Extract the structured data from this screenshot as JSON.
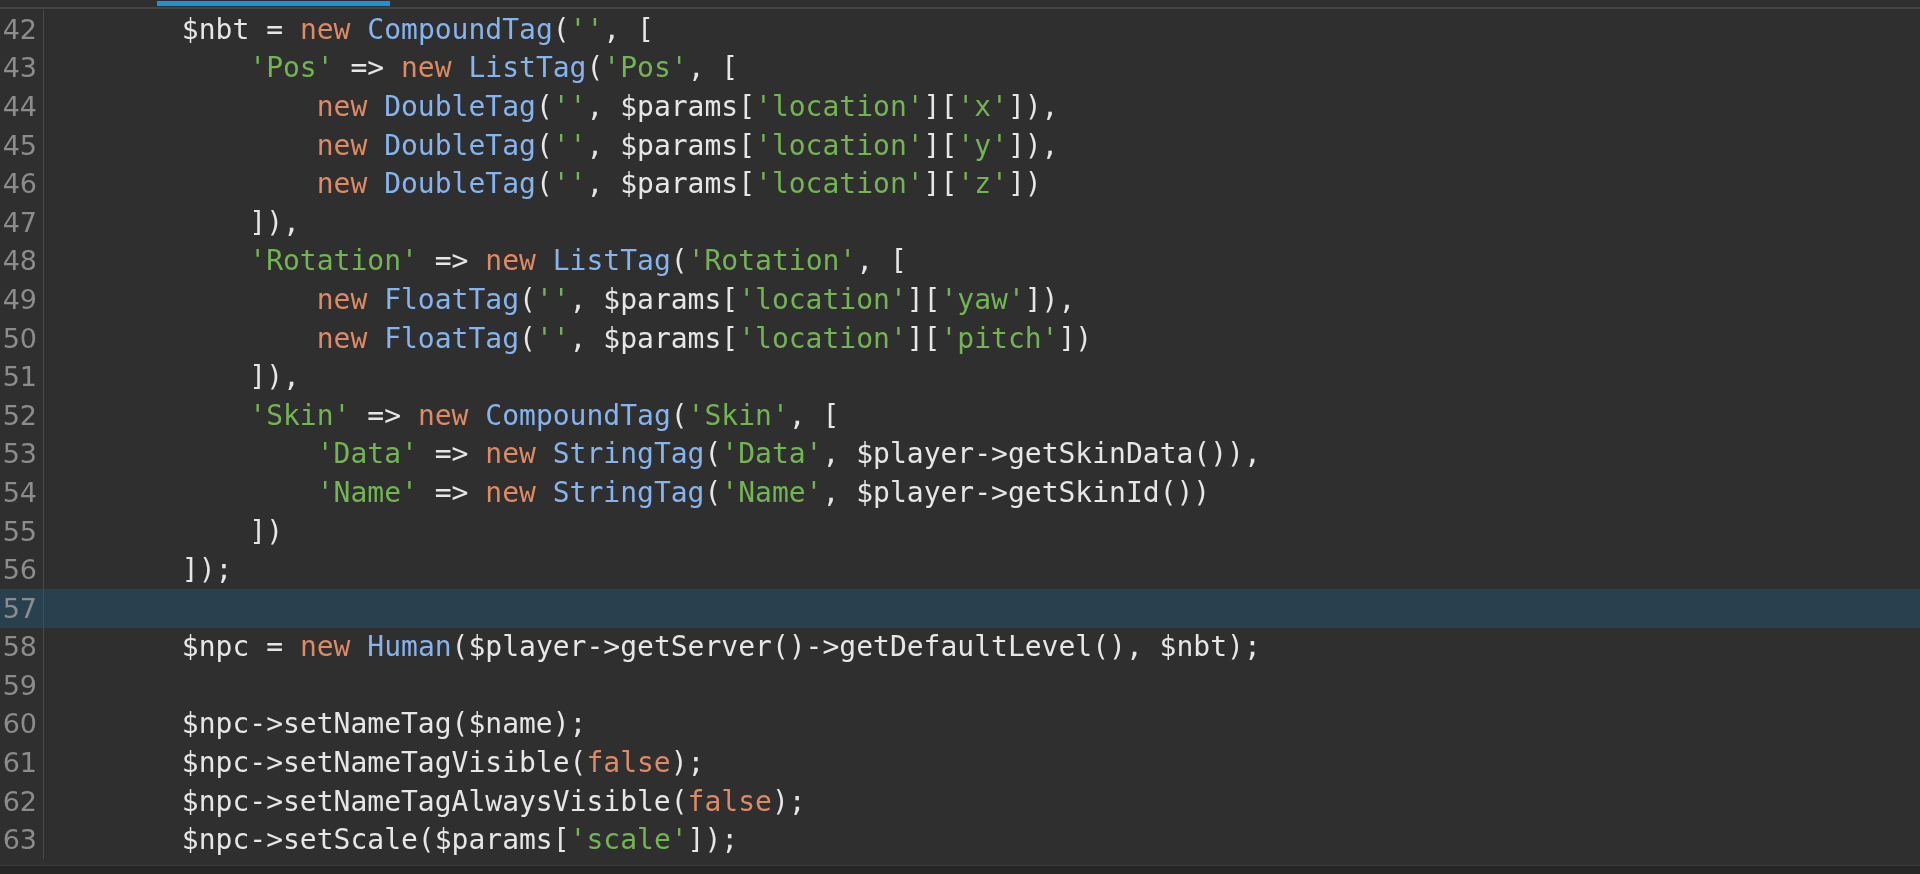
{
  "tabs": [
    {
      "selected": true
    }
  ],
  "lines": [
    {
      "number": "42",
      "current": false,
      "tokens": [
        {
          "kind": "plain",
          "text": "        $nbt = "
        },
        {
          "kind": "keyword",
          "text": "new "
        },
        {
          "kind": "type",
          "text": "CompoundTag"
        },
        {
          "kind": "plain",
          "text": "("
        },
        {
          "kind": "string",
          "text": "''"
        },
        {
          "kind": "plain",
          "text": ", ["
        }
      ]
    },
    {
      "number": "43",
      "current": false,
      "tokens": [
        {
          "kind": "string",
          "text": "            'Pos'"
        },
        {
          "kind": "plain",
          "text": " => "
        },
        {
          "kind": "keyword",
          "text": "new "
        },
        {
          "kind": "type",
          "text": "ListTag"
        },
        {
          "kind": "plain",
          "text": "("
        },
        {
          "kind": "string",
          "text": "'Pos'"
        },
        {
          "kind": "plain",
          "text": ", ["
        }
      ]
    },
    {
      "number": "44",
      "current": false,
      "tokens": [
        {
          "kind": "keyword",
          "text": "                new "
        },
        {
          "kind": "type",
          "text": "DoubleTag"
        },
        {
          "kind": "plain",
          "text": "("
        },
        {
          "kind": "string",
          "text": "''"
        },
        {
          "kind": "plain",
          "text": ", $params["
        },
        {
          "kind": "string",
          "text": "'location'"
        },
        {
          "kind": "plain",
          "text": "]["
        },
        {
          "kind": "string",
          "text": "'x'"
        },
        {
          "kind": "plain",
          "text": "]),"
        }
      ]
    },
    {
      "number": "45",
      "current": false,
      "tokens": [
        {
          "kind": "keyword",
          "text": "                new "
        },
        {
          "kind": "type",
          "text": "DoubleTag"
        },
        {
          "kind": "plain",
          "text": "("
        },
        {
          "kind": "string",
          "text": "''"
        },
        {
          "kind": "plain",
          "text": ", $params["
        },
        {
          "kind": "string",
          "text": "'location'"
        },
        {
          "kind": "plain",
          "text": "]["
        },
        {
          "kind": "string",
          "text": "'y'"
        },
        {
          "kind": "plain",
          "text": "]),"
        }
      ]
    },
    {
      "number": "46",
      "current": false,
      "tokens": [
        {
          "kind": "keyword",
          "text": "                new "
        },
        {
          "kind": "type",
          "text": "DoubleTag"
        },
        {
          "kind": "plain",
          "text": "("
        },
        {
          "kind": "string",
          "text": "''"
        },
        {
          "kind": "plain",
          "text": ", $params["
        },
        {
          "kind": "string",
          "text": "'location'"
        },
        {
          "kind": "plain",
          "text": "]["
        },
        {
          "kind": "string",
          "text": "'z'"
        },
        {
          "kind": "plain",
          "text": "])"
        }
      ]
    },
    {
      "number": "47",
      "current": false,
      "tokens": [
        {
          "kind": "plain",
          "text": "            ]),"
        }
      ]
    },
    {
      "number": "48",
      "current": false,
      "tokens": [
        {
          "kind": "string",
          "text": "            'Rotation'"
        },
        {
          "kind": "plain",
          "text": " => "
        },
        {
          "kind": "keyword",
          "text": "new "
        },
        {
          "kind": "type",
          "text": "ListTag"
        },
        {
          "kind": "plain",
          "text": "("
        },
        {
          "kind": "string",
          "text": "'Rotation'"
        },
        {
          "kind": "plain",
          "text": ", ["
        }
      ]
    },
    {
      "number": "49",
      "current": false,
      "tokens": [
        {
          "kind": "keyword",
          "text": "                new "
        },
        {
          "kind": "type",
          "text": "FloatTag"
        },
        {
          "kind": "plain",
          "text": "("
        },
        {
          "kind": "string",
          "text": "''"
        },
        {
          "kind": "plain",
          "text": ", $params["
        },
        {
          "kind": "string",
          "text": "'location'"
        },
        {
          "kind": "plain",
          "text": "]["
        },
        {
          "kind": "string",
          "text": "'yaw'"
        },
        {
          "kind": "plain",
          "text": "]),"
        }
      ]
    },
    {
      "number": "50",
      "current": false,
      "tokens": [
        {
          "kind": "keyword",
          "text": "                new "
        },
        {
          "kind": "type",
          "text": "FloatTag"
        },
        {
          "kind": "plain",
          "text": "("
        },
        {
          "kind": "string",
          "text": "''"
        },
        {
          "kind": "plain",
          "text": ", $params["
        },
        {
          "kind": "string",
          "text": "'location'"
        },
        {
          "kind": "plain",
          "text": "]["
        },
        {
          "kind": "string",
          "text": "'pitch'"
        },
        {
          "kind": "plain",
          "text": "])"
        }
      ]
    },
    {
      "number": "51",
      "current": false,
      "tokens": [
        {
          "kind": "plain",
          "text": "            ]),"
        }
      ]
    },
    {
      "number": "52",
      "current": false,
      "tokens": [
        {
          "kind": "string",
          "text": "            'Skin'"
        },
        {
          "kind": "plain",
          "text": " => "
        },
        {
          "kind": "keyword",
          "text": "new "
        },
        {
          "kind": "type",
          "text": "CompoundTag"
        },
        {
          "kind": "plain",
          "text": "("
        },
        {
          "kind": "string",
          "text": "'Skin'"
        },
        {
          "kind": "plain",
          "text": ", ["
        }
      ]
    },
    {
      "number": "53",
      "current": false,
      "tokens": [
        {
          "kind": "string",
          "text": "                'Data'"
        },
        {
          "kind": "plain",
          "text": " => "
        },
        {
          "kind": "keyword",
          "text": "new "
        },
        {
          "kind": "type",
          "text": "StringTag"
        },
        {
          "kind": "plain",
          "text": "("
        },
        {
          "kind": "string",
          "text": "'Data'"
        },
        {
          "kind": "plain",
          "text": ", $player->getSkinData()),"
        }
      ]
    },
    {
      "number": "54",
      "current": false,
      "tokens": [
        {
          "kind": "string",
          "text": "                'Name'"
        },
        {
          "kind": "plain",
          "text": " => "
        },
        {
          "kind": "keyword",
          "text": "new "
        },
        {
          "kind": "type",
          "text": "StringTag"
        },
        {
          "kind": "plain",
          "text": "("
        },
        {
          "kind": "string",
          "text": "'Name'"
        },
        {
          "kind": "plain",
          "text": ", $player->getSkinId())"
        }
      ]
    },
    {
      "number": "55",
      "current": false,
      "tokens": [
        {
          "kind": "plain",
          "text": "            ])"
        }
      ]
    },
    {
      "number": "56",
      "current": false,
      "tokens": [
        {
          "kind": "plain",
          "text": "        ]);"
        }
      ]
    },
    {
      "number": "57",
      "current": true
    },
    {
      "number": "58",
      "current": false,
      "tokens": [
        {
          "kind": "plain",
          "text": "        $npc = "
        },
        {
          "kind": "keyword",
          "text": "new "
        },
        {
          "kind": "type",
          "text": "Human"
        },
        {
          "kind": "plain",
          "text": "($player->getServer()->getDefaultLevel(), $nbt);"
        }
      ]
    },
    {
      "number": "59",
      "current": false
    },
    {
      "number": "60",
      "current": false,
      "tokens": [
        {
          "kind": "plain",
          "text": "        $npc->setNameTag($name);"
        }
      ]
    },
    {
      "number": "61",
      "current": false,
      "tokens": [
        {
          "kind": "plain",
          "text": "        $npc->setNameTagVisible("
        },
        {
          "kind": "keyword",
          "text": "false"
        },
        {
          "kind": "plain",
          "text": ");"
        }
      ]
    },
    {
      "number": "62",
      "current": false,
      "tokens": [
        {
          "kind": "plain",
          "text": "        $npc->setNameTagAlwaysVisible("
        },
        {
          "kind": "keyword",
          "text": "false"
        },
        {
          "kind": "plain",
          "text": ");"
        }
      ]
    },
    {
      "number": "63",
      "current": false,
      "tokens": [
        {
          "kind": "plain",
          "text": "        $npc->setScale($params["
        },
        {
          "kind": "string",
          "text": "'scale'"
        },
        {
          "kind": "plain",
          "text": "]);"
        }
      ]
    }
  ]
}
